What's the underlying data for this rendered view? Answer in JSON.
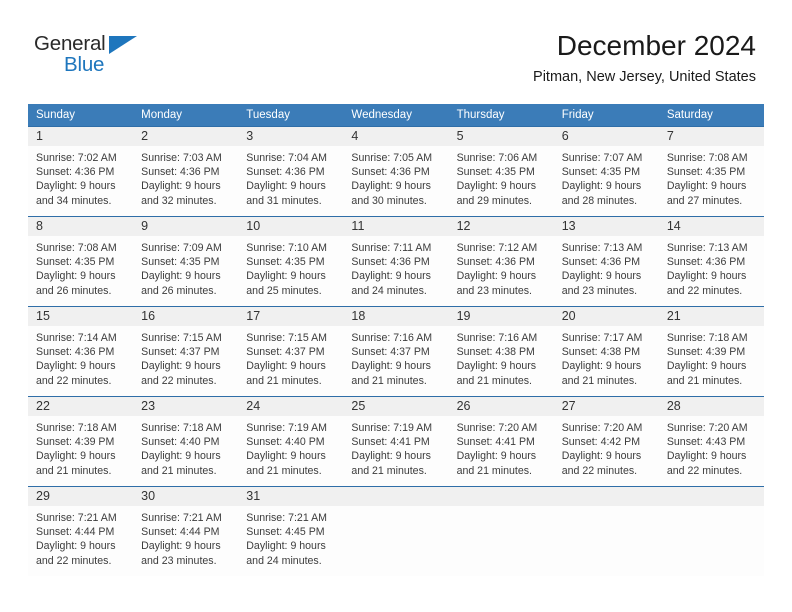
{
  "logo": {
    "text_top": "General",
    "text_bottom": "Blue",
    "triangle_color": "#1e76bd",
    "top_color": "#2a2a2a"
  },
  "header": {
    "title": "December 2024",
    "subtitle": "Pitman, New Jersey, United States"
  },
  "colors": {
    "header_band": "#3b7cb8",
    "week_divider": "#2f6ea8",
    "daynum_band": "#f0f0f0",
    "cell_background": "#fdfdfd"
  },
  "weekdays": [
    "Sunday",
    "Monday",
    "Tuesday",
    "Wednesday",
    "Thursday",
    "Friday",
    "Saturday"
  ],
  "weeks": [
    [
      {
        "day": "1",
        "sunrise": "Sunrise: 7:02 AM",
        "sunset": "Sunset: 4:36 PM",
        "daylight1": "Daylight: 9 hours",
        "daylight2": "and 34 minutes."
      },
      {
        "day": "2",
        "sunrise": "Sunrise: 7:03 AM",
        "sunset": "Sunset: 4:36 PM",
        "daylight1": "Daylight: 9 hours",
        "daylight2": "and 32 minutes."
      },
      {
        "day": "3",
        "sunrise": "Sunrise: 7:04 AM",
        "sunset": "Sunset: 4:36 PM",
        "daylight1": "Daylight: 9 hours",
        "daylight2": "and 31 minutes."
      },
      {
        "day": "4",
        "sunrise": "Sunrise: 7:05 AM",
        "sunset": "Sunset: 4:36 PM",
        "daylight1": "Daylight: 9 hours",
        "daylight2": "and 30 minutes."
      },
      {
        "day": "5",
        "sunrise": "Sunrise: 7:06 AM",
        "sunset": "Sunset: 4:35 PM",
        "daylight1": "Daylight: 9 hours",
        "daylight2": "and 29 minutes."
      },
      {
        "day": "6",
        "sunrise": "Sunrise: 7:07 AM",
        "sunset": "Sunset: 4:35 PM",
        "daylight1": "Daylight: 9 hours",
        "daylight2": "and 28 minutes."
      },
      {
        "day": "7",
        "sunrise": "Sunrise: 7:08 AM",
        "sunset": "Sunset: 4:35 PM",
        "daylight1": "Daylight: 9 hours",
        "daylight2": "and 27 minutes."
      }
    ],
    [
      {
        "day": "8",
        "sunrise": "Sunrise: 7:08 AM",
        "sunset": "Sunset: 4:35 PM",
        "daylight1": "Daylight: 9 hours",
        "daylight2": "and 26 minutes."
      },
      {
        "day": "9",
        "sunrise": "Sunrise: 7:09 AM",
        "sunset": "Sunset: 4:35 PM",
        "daylight1": "Daylight: 9 hours",
        "daylight2": "and 26 minutes."
      },
      {
        "day": "10",
        "sunrise": "Sunrise: 7:10 AM",
        "sunset": "Sunset: 4:35 PM",
        "daylight1": "Daylight: 9 hours",
        "daylight2": "and 25 minutes."
      },
      {
        "day": "11",
        "sunrise": "Sunrise: 7:11 AM",
        "sunset": "Sunset: 4:36 PM",
        "daylight1": "Daylight: 9 hours",
        "daylight2": "and 24 minutes."
      },
      {
        "day": "12",
        "sunrise": "Sunrise: 7:12 AM",
        "sunset": "Sunset: 4:36 PM",
        "daylight1": "Daylight: 9 hours",
        "daylight2": "and 23 minutes."
      },
      {
        "day": "13",
        "sunrise": "Sunrise: 7:13 AM",
        "sunset": "Sunset: 4:36 PM",
        "daylight1": "Daylight: 9 hours",
        "daylight2": "and 23 minutes."
      },
      {
        "day": "14",
        "sunrise": "Sunrise: 7:13 AM",
        "sunset": "Sunset: 4:36 PM",
        "daylight1": "Daylight: 9 hours",
        "daylight2": "and 22 minutes."
      }
    ],
    [
      {
        "day": "15",
        "sunrise": "Sunrise: 7:14 AM",
        "sunset": "Sunset: 4:36 PM",
        "daylight1": "Daylight: 9 hours",
        "daylight2": "and 22 minutes."
      },
      {
        "day": "16",
        "sunrise": "Sunrise: 7:15 AM",
        "sunset": "Sunset: 4:37 PM",
        "daylight1": "Daylight: 9 hours",
        "daylight2": "and 22 minutes."
      },
      {
        "day": "17",
        "sunrise": "Sunrise: 7:15 AM",
        "sunset": "Sunset: 4:37 PM",
        "daylight1": "Daylight: 9 hours",
        "daylight2": "and 21 minutes."
      },
      {
        "day": "18",
        "sunrise": "Sunrise: 7:16 AM",
        "sunset": "Sunset: 4:37 PM",
        "daylight1": "Daylight: 9 hours",
        "daylight2": "and 21 minutes."
      },
      {
        "day": "19",
        "sunrise": "Sunrise: 7:16 AM",
        "sunset": "Sunset: 4:38 PM",
        "daylight1": "Daylight: 9 hours",
        "daylight2": "and 21 minutes."
      },
      {
        "day": "20",
        "sunrise": "Sunrise: 7:17 AM",
        "sunset": "Sunset: 4:38 PM",
        "daylight1": "Daylight: 9 hours",
        "daylight2": "and 21 minutes."
      },
      {
        "day": "21",
        "sunrise": "Sunrise: 7:18 AM",
        "sunset": "Sunset: 4:39 PM",
        "daylight1": "Daylight: 9 hours",
        "daylight2": "and 21 minutes."
      }
    ],
    [
      {
        "day": "22",
        "sunrise": "Sunrise: 7:18 AM",
        "sunset": "Sunset: 4:39 PM",
        "daylight1": "Daylight: 9 hours",
        "daylight2": "and 21 minutes."
      },
      {
        "day": "23",
        "sunrise": "Sunrise: 7:18 AM",
        "sunset": "Sunset: 4:40 PM",
        "daylight1": "Daylight: 9 hours",
        "daylight2": "and 21 minutes."
      },
      {
        "day": "24",
        "sunrise": "Sunrise: 7:19 AM",
        "sunset": "Sunset: 4:40 PM",
        "daylight1": "Daylight: 9 hours",
        "daylight2": "and 21 minutes."
      },
      {
        "day": "25",
        "sunrise": "Sunrise: 7:19 AM",
        "sunset": "Sunset: 4:41 PM",
        "daylight1": "Daylight: 9 hours",
        "daylight2": "and 21 minutes."
      },
      {
        "day": "26",
        "sunrise": "Sunrise: 7:20 AM",
        "sunset": "Sunset: 4:41 PM",
        "daylight1": "Daylight: 9 hours",
        "daylight2": "and 21 minutes."
      },
      {
        "day": "27",
        "sunrise": "Sunrise: 7:20 AM",
        "sunset": "Sunset: 4:42 PM",
        "daylight1": "Daylight: 9 hours",
        "daylight2": "and 22 minutes."
      },
      {
        "day": "28",
        "sunrise": "Sunrise: 7:20 AM",
        "sunset": "Sunset: 4:43 PM",
        "daylight1": "Daylight: 9 hours",
        "daylight2": "and 22 minutes."
      }
    ],
    [
      {
        "day": "29",
        "sunrise": "Sunrise: 7:21 AM",
        "sunset": "Sunset: 4:44 PM",
        "daylight1": "Daylight: 9 hours",
        "daylight2": "and 22 minutes."
      },
      {
        "day": "30",
        "sunrise": "Sunrise: 7:21 AM",
        "sunset": "Sunset: 4:44 PM",
        "daylight1": "Daylight: 9 hours",
        "daylight2": "and 23 minutes."
      },
      {
        "day": "31",
        "sunrise": "Sunrise: 7:21 AM",
        "sunset": "Sunset: 4:45 PM",
        "daylight1": "Daylight: 9 hours",
        "daylight2": "and 24 minutes."
      },
      {
        "day": "",
        "sunrise": "",
        "sunset": "",
        "daylight1": "",
        "daylight2": ""
      },
      {
        "day": "",
        "sunrise": "",
        "sunset": "",
        "daylight1": "",
        "daylight2": ""
      },
      {
        "day": "",
        "sunrise": "",
        "sunset": "",
        "daylight1": "",
        "daylight2": ""
      },
      {
        "day": "",
        "sunrise": "",
        "sunset": "",
        "daylight1": "",
        "daylight2": ""
      }
    ]
  ]
}
